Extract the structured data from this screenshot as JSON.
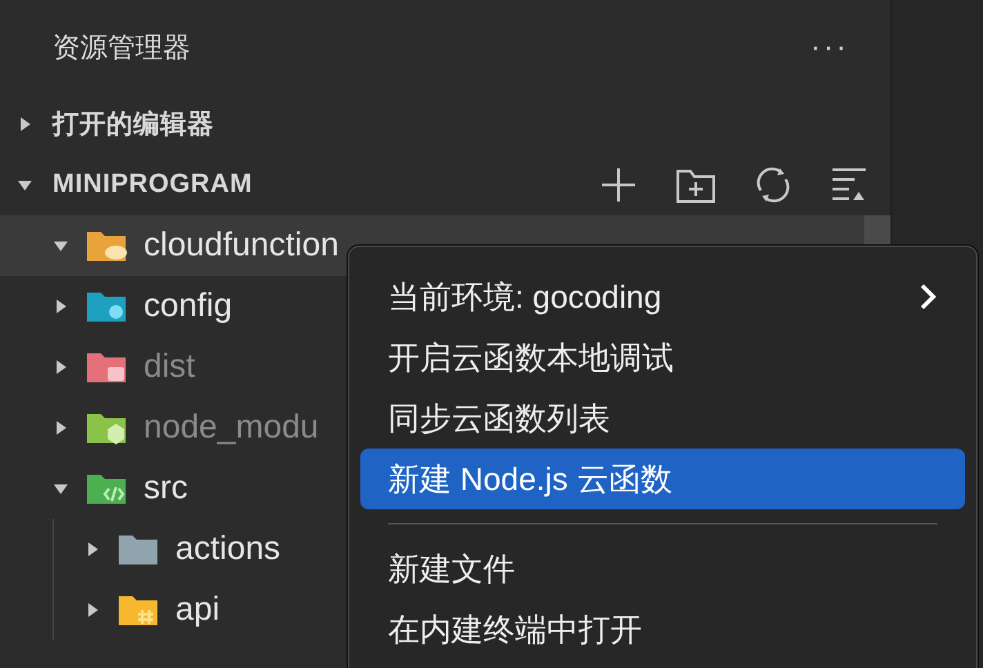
{
  "explorer": {
    "title": "资源管理器",
    "more": "···"
  },
  "sections": [
    {
      "title": "打开的编辑器",
      "expanded": false
    },
    {
      "title": "MINIPROGRAM",
      "expanded": true
    }
  ],
  "tree": [
    {
      "label": "cloudfunction",
      "kind": "cloud",
      "expanded": true,
      "selected": true,
      "dimmed": false
    },
    {
      "label": "config",
      "kind": "config",
      "expanded": false,
      "selected": false,
      "dimmed": false
    },
    {
      "label": "dist",
      "kind": "dist",
      "expanded": false,
      "selected": false,
      "dimmed": true
    },
    {
      "label": "node_modu",
      "kind": "node",
      "expanded": false,
      "selected": false,
      "dimmed": true
    },
    {
      "label": "src",
      "kind": "src",
      "expanded": true,
      "selected": false,
      "dimmed": false,
      "children": [
        {
          "label": "actions",
          "kind": "plain",
          "expanded": false,
          "selected": false,
          "dimmed": false
        },
        {
          "label": "api",
          "kind": "api",
          "expanded": false,
          "selected": false,
          "dimmed": false
        }
      ]
    }
  ],
  "menu": [
    [
      {
        "label": "当前环境: gocoding",
        "submenu": true,
        "selected": false
      },
      {
        "label": "开启云函数本地调试",
        "submenu": false,
        "selected": false
      },
      {
        "label": "同步云函数列表",
        "submenu": false,
        "selected": false
      },
      {
        "label": "新建 Node.js 云函数",
        "submenu": false,
        "selected": true
      }
    ],
    [
      {
        "label": "新建文件",
        "submenu": false,
        "selected": false
      },
      {
        "label": "在内建终端中打开",
        "submenu": false,
        "selected": false
      }
    ]
  ]
}
